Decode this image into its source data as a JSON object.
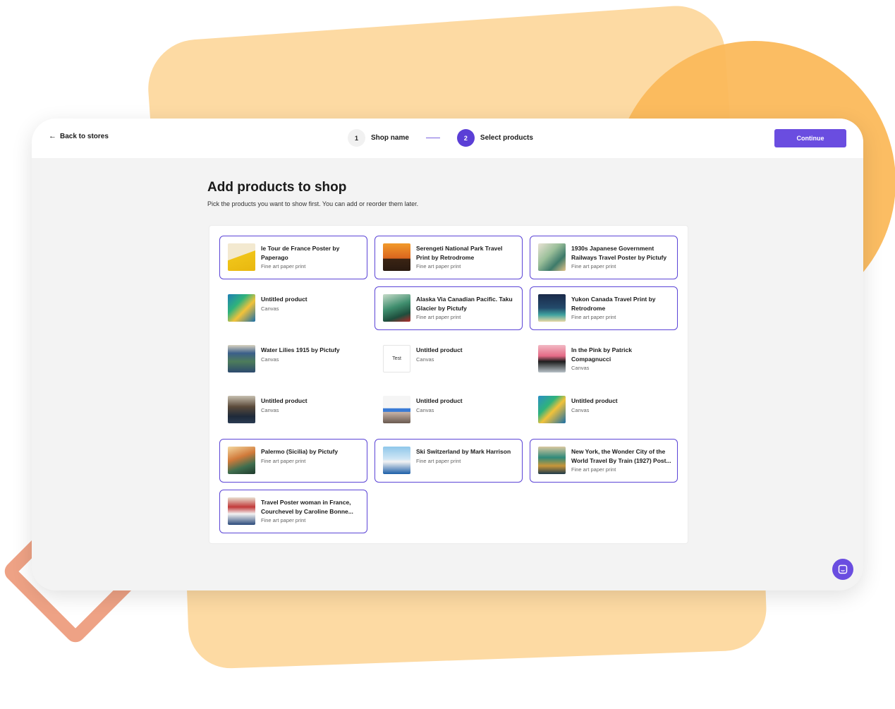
{
  "header": {
    "back_label": "Back to stores",
    "steps": [
      {
        "number": "1",
        "label": "Shop name"
      },
      {
        "number": "2",
        "label": "Select products"
      }
    ],
    "continue_label": "Continue"
  },
  "main": {
    "title": "Add products to shop",
    "subtitle": "Pick the products you want to show first. You can add or reorder them later."
  },
  "products": [
    {
      "title": "le Tour de France Poster by Paperago",
      "type": "Fine art paper print",
      "selected": true
    },
    {
      "title": "Serengeti National Park Travel Print by Retrodrome",
      "type": "Fine art paper print",
      "selected": true
    },
    {
      "title": "1930s Japanese Government Railways Travel Poster by Pictufy",
      "type": "Fine art paper print",
      "selected": true
    },
    {
      "title": "Untitled product",
      "type": "Canvas",
      "selected": false
    },
    {
      "title": "Alaska Via Canadian Pacific. Taku Glacier by Pictufy",
      "type": "Fine art paper print",
      "selected": true
    },
    {
      "title": "Yukon Canada Travel Print by Retrodrome",
      "type": "Fine art paper print",
      "selected": true
    },
    {
      "title": "Water Lilies 1915 by Pictufy",
      "type": "Canvas",
      "selected": false
    },
    {
      "title": "Untitled product",
      "type": "Canvas",
      "selected": false,
      "thumb_text": "Test"
    },
    {
      "title": "In the Pink by Patrick Compagnucci",
      "type": "Canvas",
      "selected": false
    },
    {
      "title": "Untitled product",
      "type": "Canvas",
      "selected": false
    },
    {
      "title": "Untitled product",
      "type": "Canvas",
      "selected": false
    },
    {
      "title": "Untitled product",
      "type": "Canvas",
      "selected": false
    },
    {
      "title": "Palermo (Sicilia) by Pictufy",
      "type": "Fine art paper print",
      "selected": true
    },
    {
      "title": "Ski Switzerland by Mark Harrison",
      "type": "Fine art paper print",
      "selected": true
    },
    {
      "title": "New York, the Wonder City of the World Travel By Train (1927) Post...",
      "type": "Fine art paper print",
      "selected": true
    },
    {
      "title": "Travel Poster woman in France, Courchevel by Caroline Bonne...",
      "type": "Fine art paper print",
      "selected": true
    }
  ],
  "colors": {
    "accent": "#6a4de0",
    "selected_border": "#5b44d6",
    "deco_peach": "#fddaa3",
    "deco_orange": "#fbb95b",
    "deco_coral": "#eea285"
  },
  "icons": {
    "back": "arrow-left-icon",
    "chat": "chat-icon"
  }
}
